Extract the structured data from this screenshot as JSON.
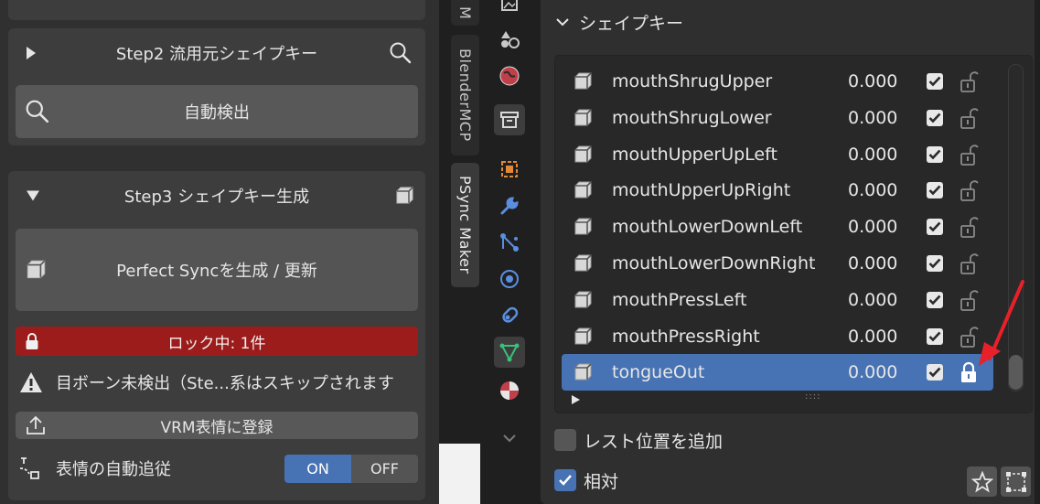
{
  "left_panel": {
    "step2": {
      "title": "Step2 流用元シェイプキー",
      "detect_button": "自動検出"
    },
    "step3": {
      "title": "Step3 シェイプキー生成",
      "generate_button": "Perfect Syncを生成 / 更新",
      "lock_status": "ロック中: 1件",
      "warning": "目ボーン未検出（Ste...系はスキップされます",
      "register_button": "VRM表情に登録",
      "auto_follow_label": "表情の自動追従",
      "toggle_on": "ON",
      "toggle_off": "OFF",
      "toggle_selected": "ON"
    }
  },
  "side_tabs": {
    "partial_top": "M",
    "blendermcp": "BlenderMCP",
    "psync": "PSync Maker"
  },
  "right_panel": {
    "header": "シェイプキー",
    "shape_keys": [
      {
        "name": "mouthShrugUpper",
        "value": "0.000",
        "checked": true,
        "locked": false
      },
      {
        "name": "mouthShrugLower",
        "value": "0.000",
        "checked": true,
        "locked": false
      },
      {
        "name": "mouthUpperUpLeft",
        "value": "0.000",
        "checked": true,
        "locked": false
      },
      {
        "name": "mouthUpperUpRight",
        "value": "0.000",
        "checked": true,
        "locked": false
      },
      {
        "name": "mouthLowerDownLeft",
        "value": "0.000",
        "checked": true,
        "locked": false
      },
      {
        "name": "mouthLowerDownRight",
        "value": "0.000",
        "checked": true,
        "locked": false
      },
      {
        "name": "mouthPressLeft",
        "value": "0.000",
        "checked": true,
        "locked": false
      },
      {
        "name": "mouthPressRight",
        "value": "0.000",
        "checked": true,
        "locked": false
      },
      {
        "name": "tongueOut",
        "value": "0.000",
        "checked": true,
        "locked": true,
        "selected": true
      }
    ],
    "add_rest_label": "レスト位置を追加",
    "relative_label": "相対",
    "relative_checked": true
  },
  "colors": {
    "accent": "#4772b3",
    "lock_bar": "#9c1c1c",
    "arrow": "#e8202a"
  }
}
